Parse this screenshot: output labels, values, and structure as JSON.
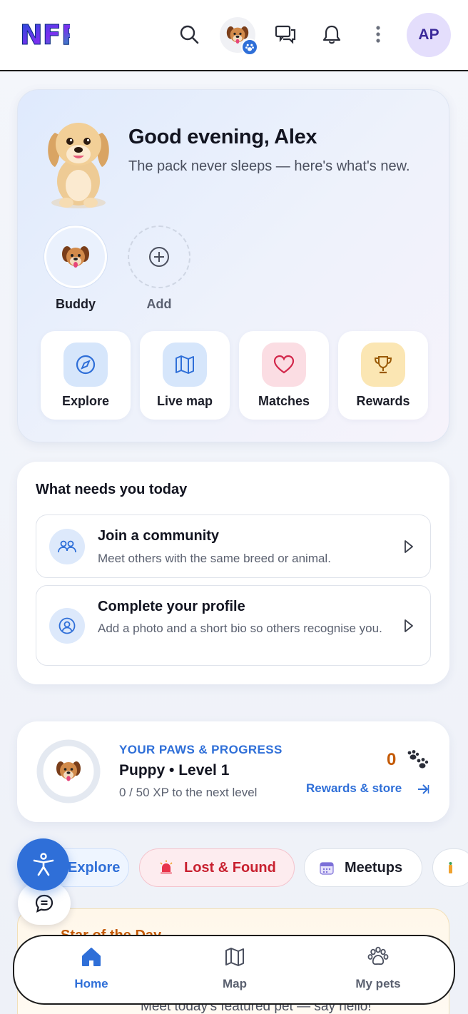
{
  "header": {
    "logo_text": "NFP",
    "avatar_initials": "AP"
  },
  "hero": {
    "greeting": "Good evening, Alex",
    "subtitle": "The pack never sleeps — here's what's new.",
    "pets": [
      {
        "name": "Buddy"
      },
      {
        "name": "Add"
      }
    ],
    "quick_actions": [
      {
        "label": "Explore",
        "icon": "compass-icon",
        "color": "#d6e6fb"
      },
      {
        "label": "Live map",
        "icon": "map-icon",
        "color": "#d6e6fb"
      },
      {
        "label": "Matches",
        "icon": "heart-icon",
        "color": "#fbdde3"
      },
      {
        "label": "Rewards",
        "icon": "trophy-icon",
        "color": "#fbe6b3"
      }
    ]
  },
  "needs": {
    "title": "What needs you today",
    "tasks": [
      {
        "title": "Join a community",
        "desc": "Meet others with the same breed or animal."
      },
      {
        "title": "Complete your profile",
        "desc": "Add a photo and a short bio so others recognise you."
      }
    ]
  },
  "progress": {
    "kicker": "YOUR PAWS & PROGRESS",
    "level": "Puppy • Level 1",
    "xp_text": "0 / 50 XP to the next level",
    "xp_fraction": 0,
    "paw_count": "0",
    "link": "Rewards & store"
  },
  "chips": {
    "explore": "Explore",
    "lost_found": "Lost & Found",
    "meetups": "Meetups"
  },
  "star": {
    "title": "Star of the Day",
    "subtitle": "Meet today's featured pet — say hello!"
  },
  "nav": {
    "home": "Home",
    "map": "Map",
    "my_pets": "My pets"
  },
  "colors": {
    "accent": "#2f6fd8",
    "alert": "#c8202f",
    "orange": "#c45a06"
  }
}
